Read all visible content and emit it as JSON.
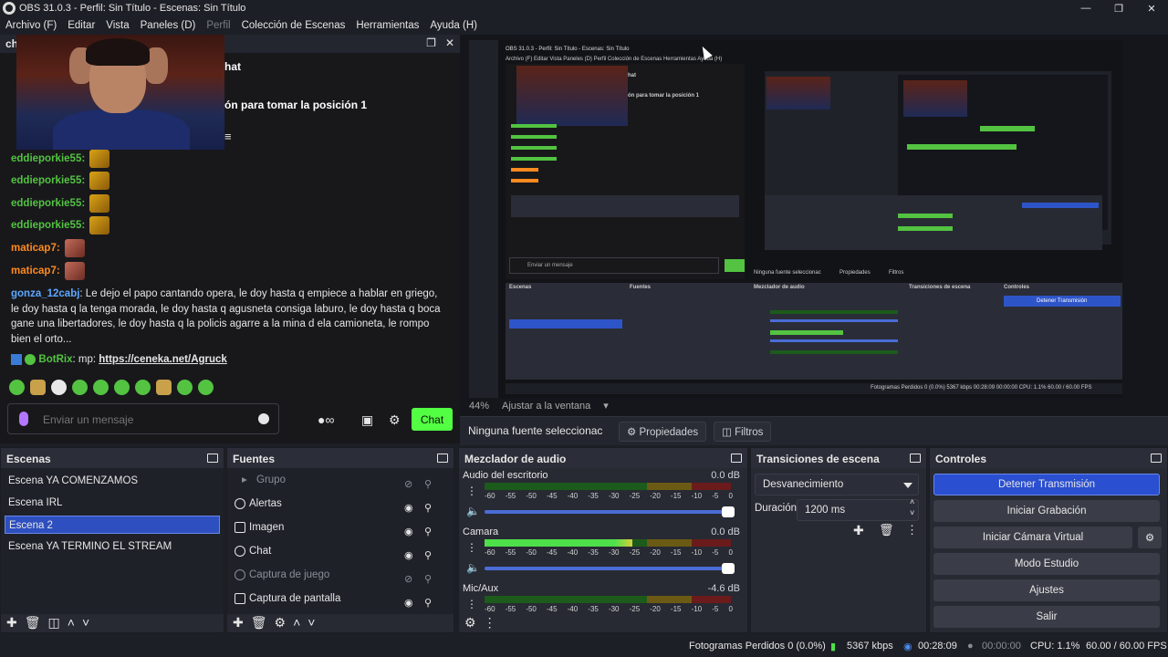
{
  "window": {
    "title": "OBS 31.0.3 - Perfil: Sin Título - Escenas: Sin Título"
  },
  "menu": {
    "items": [
      "Archivo (F)",
      "Editar",
      "Vista",
      "Paneles (D)",
      "Perfil",
      "Colección de Escenas",
      "Herramientas",
      "Ayuda (H)"
    ]
  },
  "chat": {
    "dock_title": "ch",
    "header_title": "hat",
    "header_notice": "ón para tomar la posición 1",
    "messages": [
      {
        "user": "eddieporkie55:",
        "text": "",
        "emote": "emote"
      },
      {
        "user": "eddieporkie55:",
        "text": "",
        "emote": "emote"
      },
      {
        "user": "eddieporkie55:",
        "text": "",
        "emote": "emote"
      },
      {
        "user": "eddieporkie55:",
        "text": "",
        "emote": "emote"
      },
      {
        "user": "maticap7:",
        "text": "",
        "emote": "face"
      },
      {
        "user": "maticap7:",
        "text": "",
        "emote": "face"
      }
    ],
    "long_message": {
      "user": "gonza_12cabj",
      "text": ": Le dejo el papo cantando opera, le doy hasta q empiece a hablar en griego, le doy hasta q la tenga morada, le doy hasta q agusneta consiga laburo, le doy hasta q boca gane una libertadores, le doy hasta q la policis agarre a la mina d ela camioneta, le rompo bien el orto..."
    },
    "bot_message": {
      "user": "BotRix",
      "prefix": ": mp: ",
      "link": "https://ceneka.net/Agruck"
    },
    "input_placeholder": "Enviar un mensaje",
    "send_label": "Chat",
    "colors": {
      "eddie": "#53c341",
      "maticap": "#ff8a1f",
      "gonza": "#5ea8ff",
      "bot": "#53c341",
      "send": "#53ff43"
    }
  },
  "preview": {
    "zoom": "44%",
    "fit_label": "Ajustar a la ventana",
    "no_source": "Ninguna fuente seleccionac",
    "properties": "Propiedades",
    "filters": "Filtros"
  },
  "nested": {
    "title": "OBS 31.0.3 - Perfil: Sin Título - Escenas: Sin Título",
    "menu": "Archivo (F)    Editar    Vista    Paneles (D)    Perfil    Colección de Escenas    Herramientas    Ayuda (H)",
    "header_title": "hat",
    "header_notice": "ón para tomar la posición 1",
    "input_placeholder": "Enviar un mensaje",
    "no_source": "Ninguna fuente seleccionac",
    "props": "Propiedades",
    "filters": "Filtros",
    "scenes_title": "Escenas",
    "sources_title": "Fuentes",
    "mixer_title": "Mezclador de audio",
    "trans_title": "Transiciones de escena",
    "controls_title": "Controles",
    "stop_stream": "Detener Transmisión",
    "status": "Fotogramas Perdidos 0 (0.0%)    5367 kbps    00:28:09    00:00:00    CPU: 1.1%    60.00 / 60.00 FPS"
  },
  "scenes": {
    "title": "Escenas",
    "items": [
      "Escena YA COMENZAMOS",
      "Escena IRL",
      "Escena 2",
      "Escena YA TERMINO EL STREAM"
    ],
    "selected_index": 2
  },
  "sources": {
    "title": "Fuentes",
    "items": [
      {
        "name": "Grupo",
        "icon": "folder-icon",
        "visible": false,
        "dim": true
      },
      {
        "name": "Alertas",
        "icon": "browser-icon",
        "visible": true,
        "dim": false
      },
      {
        "name": "Imagen",
        "icon": "image-icon",
        "visible": true,
        "dim": false
      },
      {
        "name": "Chat",
        "icon": "browser-icon",
        "visible": true,
        "dim": false
      },
      {
        "name": "Captura de juego",
        "icon": "gamepad-icon",
        "visible": false,
        "dim": true
      },
      {
        "name": "Captura de pantalla",
        "icon": "monitor-icon",
        "visible": true,
        "dim": false
      }
    ]
  },
  "mixer": {
    "title": "Mezclador de audio",
    "ticks": [
      "-60",
      "-55",
      "-50",
      "-45",
      "-40",
      "-35",
      "-30",
      "-25",
      "-20",
      "-15",
      "-10",
      "-5",
      "0"
    ],
    "channels": [
      {
        "name": "Audio del escritorio",
        "db": "0.0 dB",
        "level": 0
      },
      {
        "name": "Camara",
        "db": "0.0 dB",
        "level": 0.6
      },
      {
        "name": "Mic/Aux",
        "db": "-4.6 dB",
        "level": 0
      }
    ]
  },
  "transitions": {
    "title": "Transiciones de escena",
    "selected": "Desvanecimiento",
    "duration_label": "Duración",
    "duration_value": "1200 ms"
  },
  "controls": {
    "title": "Controles",
    "buttons": [
      "Detener Transmisión",
      "Iniciar Grabación",
      "Iniciar Cámara Virtual",
      "Modo Estudio",
      "Ajustes",
      "Salir"
    ]
  },
  "status": {
    "dropped": "Fotogramas Perdidos 0 (0.0%)",
    "bitrate": "5367 kbps",
    "stream_time": "00:28:09",
    "rec_time": "00:00:00",
    "cpu": "CPU: 1.1%",
    "fps": "60.00 / 60.00 FPS"
  }
}
